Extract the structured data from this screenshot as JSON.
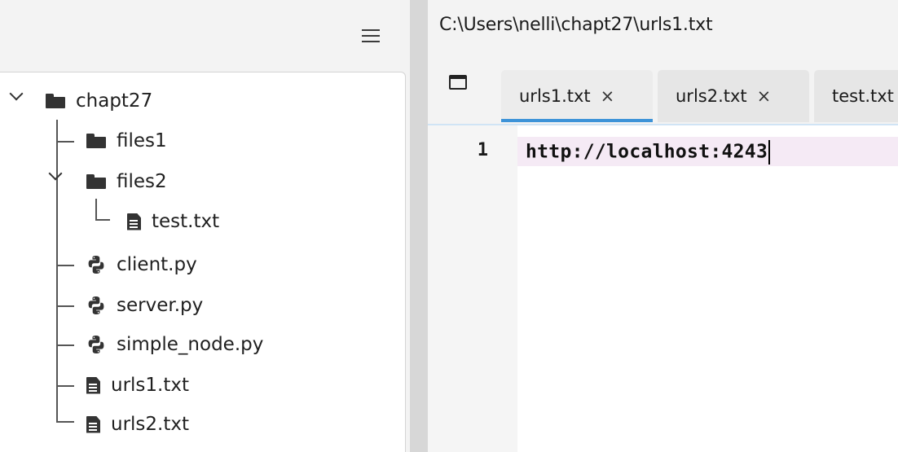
{
  "explorer": {
    "menu_icon": "hamburger-menu-icon",
    "root": {
      "label": "chapt27",
      "expanded": true,
      "icon": "folder-icon"
    },
    "items": [
      {
        "label": "files1",
        "icon": "folder-icon",
        "type": "folder"
      },
      {
        "label": "files2",
        "icon": "folder-icon",
        "type": "folder",
        "expanded": true
      },
      {
        "label": "test.txt",
        "icon": "file-text-icon",
        "type": "file",
        "parent": "files2"
      },
      {
        "label": "client.py",
        "icon": "python-icon",
        "type": "file"
      },
      {
        "label": "server.py",
        "icon": "python-icon",
        "type": "file"
      },
      {
        "label": "simple_node.py",
        "icon": "python-icon",
        "type": "file"
      },
      {
        "label": "urls1.txt",
        "icon": "file-text-icon",
        "type": "file"
      },
      {
        "label": "urls2.txt",
        "icon": "file-text-icon",
        "type": "file"
      }
    ]
  },
  "editor": {
    "path": "C:\\Users\\nelli\\chapt27\\urls1.txt",
    "tabs": [
      {
        "label": "urls1.txt",
        "close": "×",
        "active": true
      },
      {
        "label": "urls2.txt",
        "close": "×",
        "active": false
      },
      {
        "label": "test.txt",
        "close": "×",
        "active": false
      }
    ],
    "lines": [
      {
        "number": "1",
        "text": "http://localhost:4243"
      }
    ]
  },
  "colors": {
    "active_tab_underline": "#3d93d8",
    "current_line_highlight": "#f5eaf5",
    "splitter": "#d7d7d7"
  }
}
